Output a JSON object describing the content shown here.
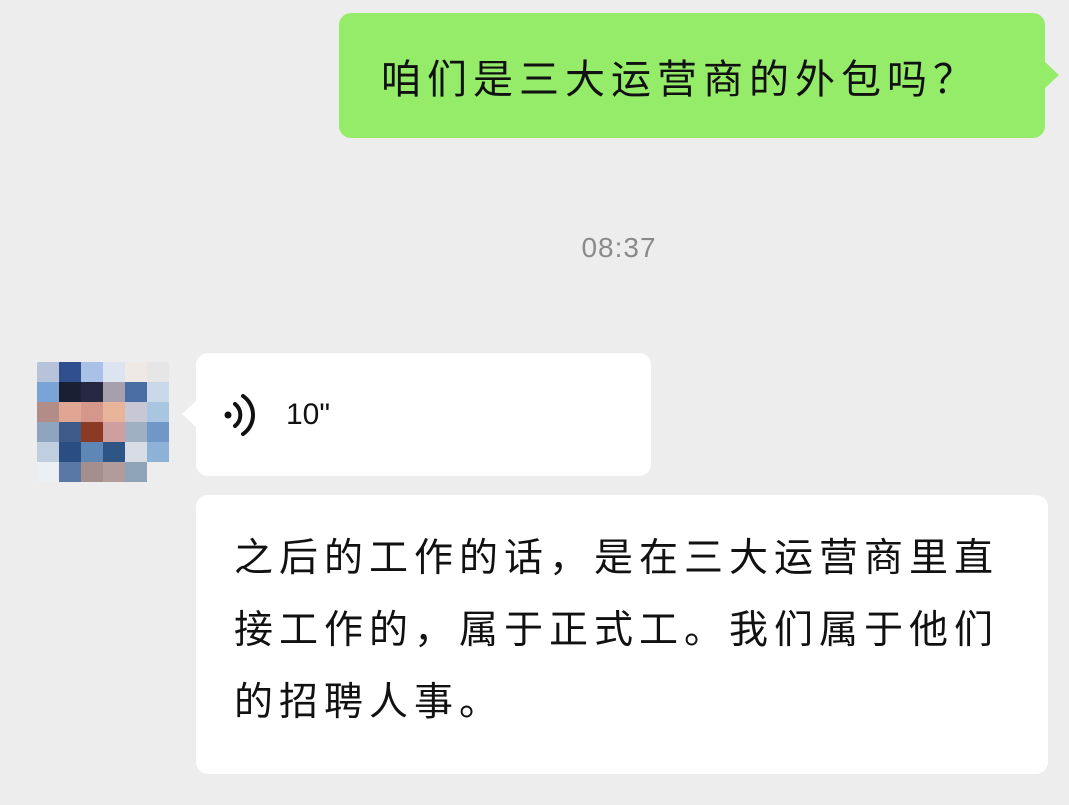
{
  "messages": [
    {
      "direction": "outgoing",
      "type": "text",
      "text": "咱们是三大运营商的外包吗？"
    },
    {
      "type": "timestamp",
      "text": "08:37"
    },
    {
      "direction": "incoming",
      "type": "voice",
      "duration": "10\"",
      "icon": "voice-wave-icon"
    },
    {
      "direction": "incoming",
      "type": "text",
      "text": "之后的工作的话，是在三大运营商里直接工作的，属于正式工。我们属于他们的招聘人事。"
    }
  ],
  "colors": {
    "background": "#ededed",
    "outgoing_bubble": "#95ec69",
    "incoming_bubble": "#ffffff",
    "timestamp": "#8a8a8a"
  }
}
